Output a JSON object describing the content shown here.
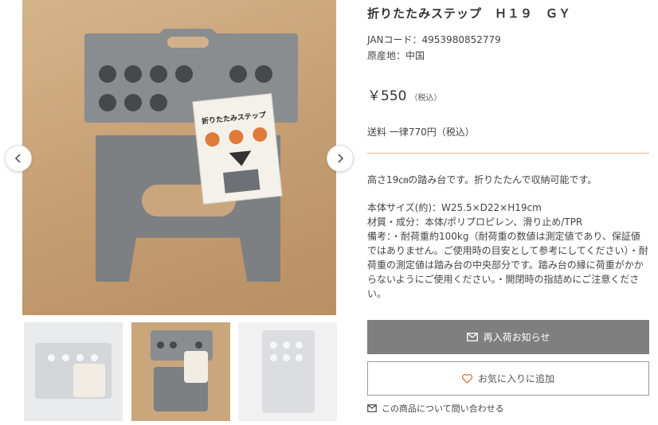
{
  "gallery": {
    "main_image_alt": "product-photo",
    "label_title": "折りたたみステップ",
    "prev_icon": "chevron-left-icon",
    "next_icon": "chevron-right-icon",
    "thumbnails": [
      "thumbnail-1",
      "thumbnail-2",
      "thumbnail-3"
    ]
  },
  "product": {
    "title": "折りたたみステップ　Ｈ１９　ＧＹ",
    "jan": "JANコード：4953980852779",
    "origin": "原産地：中国",
    "price": "￥550",
    "tax_note": "（税込）",
    "shipping": "送料 一律770円（税込）",
    "description_intro": "高さ19㎝の踏み台です。折りたたんで収納可能です。",
    "spec_size": "本体サイズ(約)：W25.5×D22×H19cm",
    "spec_material": "材質・成分：本体/ポリプロピレン、滑り止め/TPR",
    "spec_note": "備考：・耐荷重約100kg（耐荷重の数値は測定値であり、保証値ではありません。ご使用時の目安として参考にしてください）・耐荷重の測定値は踏み台の中央部分です。踏み台の縁に荷重がかからないようにご使用ください。・開閉時の指詰めにご注意ください。"
  },
  "actions": {
    "restock_label": "再入荷お知らせ",
    "favorite_label": "お気に入りに追加",
    "inquiry_label": "この商品について問い合わせる"
  },
  "colors": {
    "accent": "#e0b08c",
    "heart": "#e07a3a",
    "restock_bg": "#7f7f7f"
  }
}
